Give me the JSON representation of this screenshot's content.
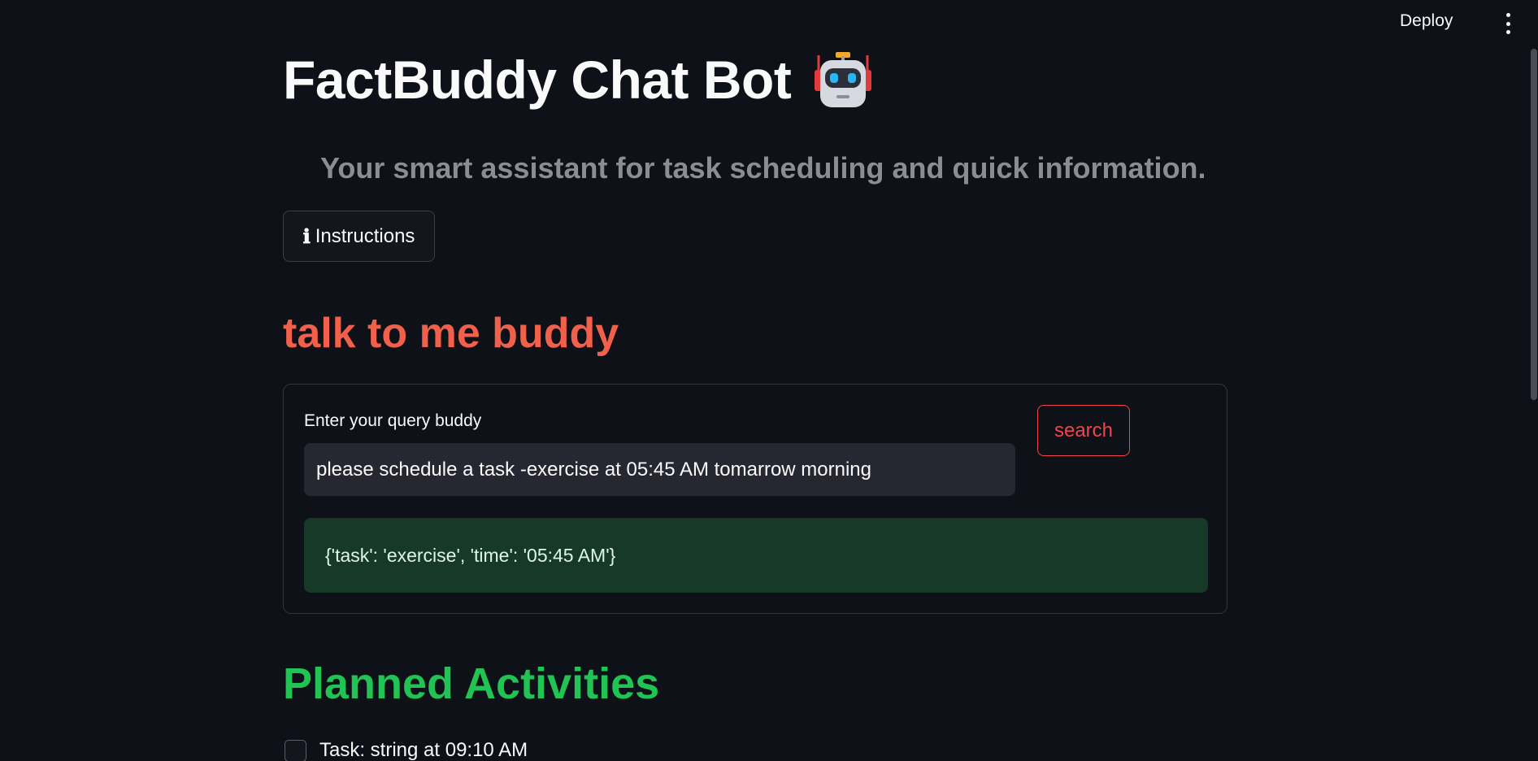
{
  "header": {
    "deploy_label": "Deploy",
    "menu_icon": "kebab-menu-icon"
  },
  "main": {
    "title": "FactBuddy Chat Bot",
    "title_icon": "robot-icon",
    "subtitle": "Your smart assistant for task scheduling and quick information.",
    "instructions_button": {
      "glyph": "ℹ",
      "label": "Instructions"
    },
    "talk_heading": "talk to me buddy",
    "form": {
      "query_label": "Enter your query buddy",
      "query_value": "please schedule a task -exercise at 05:45 AM tomarrow morning",
      "search_label": "search",
      "result_text": "{'task': 'exercise', 'time': '05:45 AM'}"
    },
    "planned_heading": "Planned Activities",
    "tasks": [
      {
        "label": "Task: string at 09:10 AM",
        "checked": false
      }
    ]
  },
  "colors": {
    "background": "#0e1117",
    "talk_heading": "#f0604a",
    "planned_heading": "#21c354",
    "search_accent": "#f0454a",
    "result_bg": "#173928"
  }
}
